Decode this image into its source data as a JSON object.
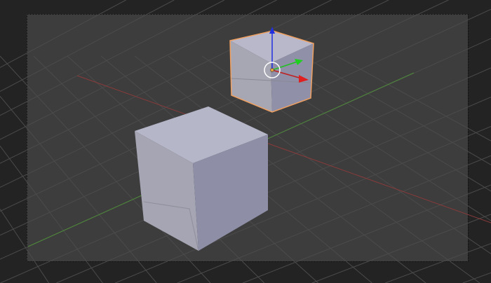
{
  "viewport": {
    "mode": "camera-view",
    "colors": {
      "outer_background": "#232323",
      "viewport_background": "#3d3d3d",
      "grid": "#4a4a4a",
      "x_axis": "#8a3a3a",
      "y_axis": "#4e8a3a",
      "cube_top": "#b4b4c8",
      "cube_left": "#a3a3b2",
      "cube_right": "#8e8ea6",
      "selection_outline": "#f0a060",
      "gizmo_x": "#e02020",
      "gizmo_y": "#20d020",
      "gizmo_z": "#2030e0"
    },
    "objects": [
      {
        "name": "cube",
        "selected": false
      },
      {
        "name": "cube-selected",
        "selected": true
      }
    ]
  }
}
